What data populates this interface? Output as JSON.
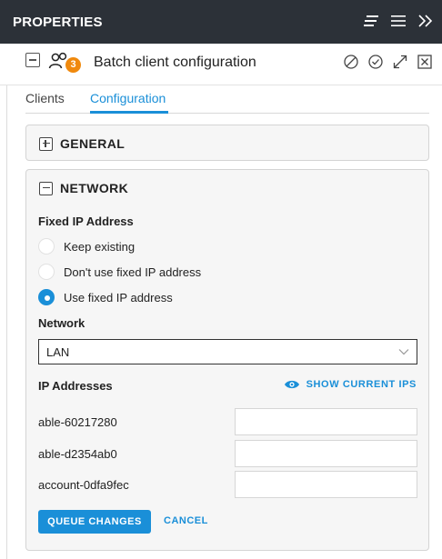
{
  "panel": {
    "title": "PROPERTIES"
  },
  "header": {
    "title": "Batch client configuration",
    "client_count": "3"
  },
  "tabs": [
    {
      "label": "Clients",
      "active": false
    },
    {
      "label": "Configuration",
      "active": true
    }
  ],
  "sections": {
    "general": {
      "title": "GENERAL",
      "expanded": false
    },
    "network": {
      "title": "NETWORK",
      "expanded": true,
      "fixed_ip": {
        "label": "Fixed IP Address",
        "options": [
          {
            "label": "Keep existing",
            "selected": false
          },
          {
            "label": "Don't use fixed IP address",
            "selected": false
          },
          {
            "label": "Use fixed IP address",
            "selected": true
          }
        ]
      },
      "network_field": {
        "label": "Network",
        "value": "LAN"
      },
      "ip_addresses": {
        "label": "IP Addresses",
        "show_current_label": "SHOW CURRENT IPS",
        "rows": [
          {
            "name": "able-60217280",
            "value": ""
          },
          {
            "name": "able-d2354ab0",
            "value": ""
          },
          {
            "name": "account-0dfa9fec",
            "value": ""
          }
        ]
      },
      "actions": {
        "queue_label": "QUEUE CHANGES",
        "cancel_label": "CANCEL"
      }
    }
  },
  "colors": {
    "accent": "#1a8fd8",
    "titlebar": "#2c3138",
    "badge": "#f0890d"
  },
  "icons": {
    "titlebar": [
      "list-view-icon",
      "menu-icon",
      "collapse-panel-icon"
    ],
    "header_actions": [
      "block-icon",
      "check-circle-icon",
      "expand-icon",
      "close-icon"
    ]
  }
}
